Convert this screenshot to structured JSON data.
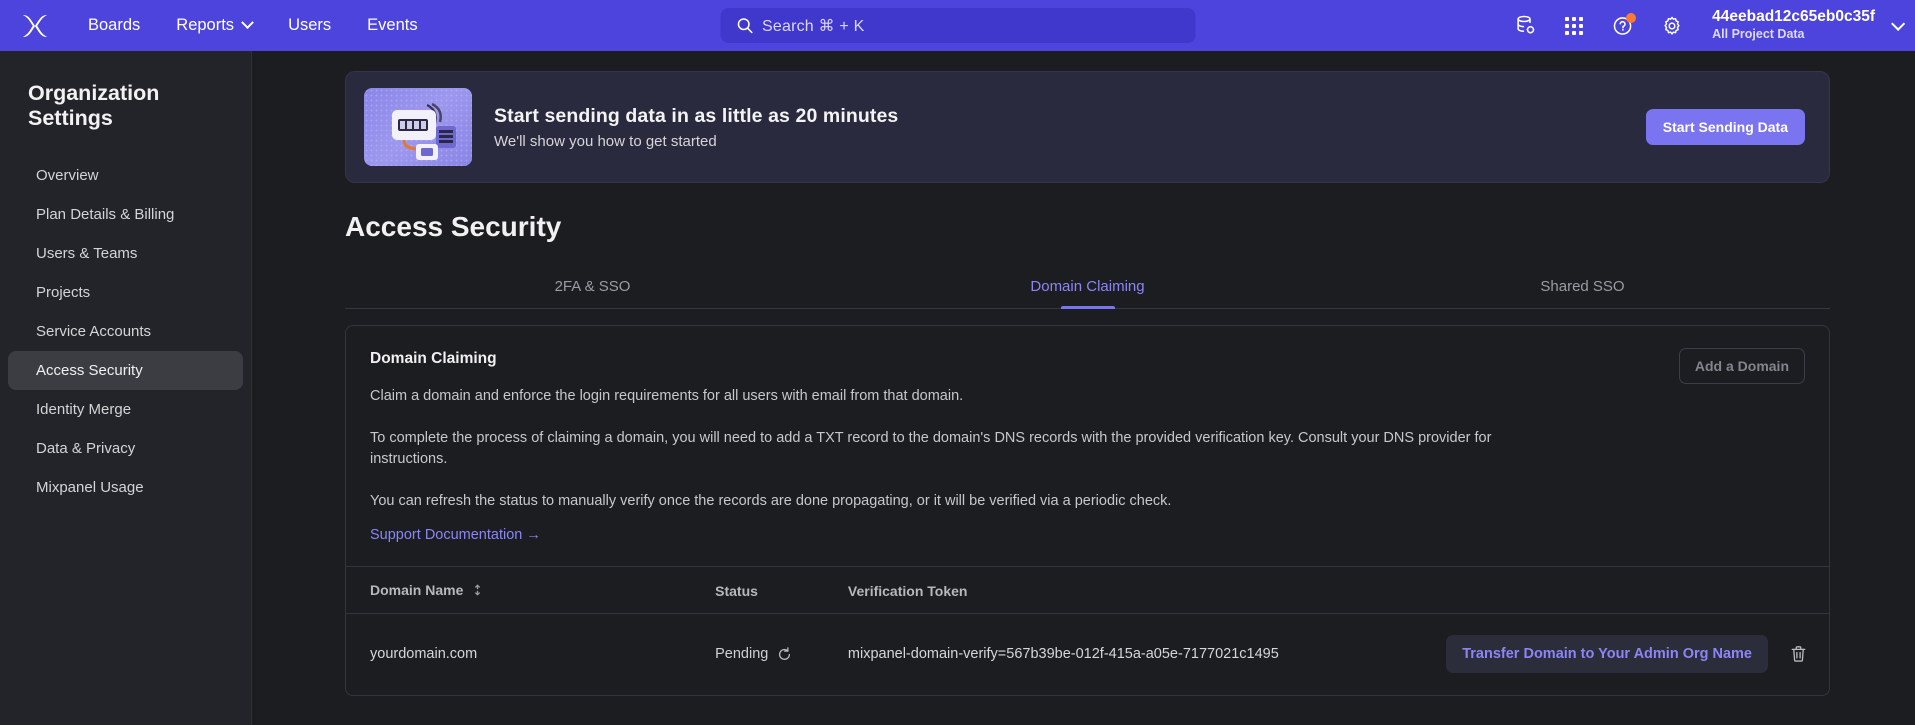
{
  "topnav": {
    "logo_name": "mixpanel-logo",
    "links": [
      {
        "label": "Boards",
        "has_caret": false
      },
      {
        "label": "Reports",
        "has_caret": true
      },
      {
        "label": "Users",
        "has_caret": false
      },
      {
        "label": "Events",
        "has_caret": false
      }
    ],
    "search": {
      "placeholder": "Search  ⌘ + K"
    },
    "icons": [
      "database-settings-icon",
      "apps-grid-icon",
      "help-circle-icon",
      "gear-icon"
    ],
    "project": {
      "name": "44eebad12c65eb0c35f",
      "subtitle": "All Project Data"
    }
  },
  "sidebar": {
    "title": "Organization Settings",
    "items": [
      {
        "label": "Overview",
        "active": false
      },
      {
        "label": "Plan Details & Billing",
        "active": false
      },
      {
        "label": "Users & Teams",
        "active": false
      },
      {
        "label": "Projects",
        "active": false
      },
      {
        "label": "Service Accounts",
        "active": false
      },
      {
        "label": "Access Security",
        "active": true
      },
      {
        "label": "Identity Merge",
        "active": false
      },
      {
        "label": "Data & Privacy",
        "active": false
      },
      {
        "label": "Mixpanel Usage",
        "active": false
      }
    ]
  },
  "banner": {
    "title": "Start sending data in as little as 20 minutes",
    "subtitle": "We'll show you how to get started",
    "cta_label": "Start Sending Data",
    "thumb_name": "server-device-illustration"
  },
  "page": {
    "title": "Access Security",
    "tabs": [
      {
        "label": "2FA & SSO",
        "active": false
      },
      {
        "label": "Domain Claiming",
        "active": true
      },
      {
        "label": "Shared SSO",
        "active": false
      }
    ]
  },
  "card": {
    "heading": "Domain Claiming",
    "paragraphs": [
      "Claim a domain and enforce the login requirements for all users with email from that domain.",
      "To complete the process of claiming a domain, you will need to add a TXT record to the domain's DNS records with the provided verification key. Consult your DNS provider for instructions.",
      "You can refresh the status to manually verify once the records are done propagating, or it will be verified via a periodic check."
    ],
    "support_link": "Support Documentation →",
    "add_domain_label": "Add a Domain"
  },
  "table": {
    "columns": [
      "Domain Name",
      "Status",
      "Verification Token"
    ],
    "rows": [
      {
        "domain": "yourdomain.com",
        "status": "Pending",
        "token": "mixpanel-domain-verify=567b39be-012f-415a-a05e-7177021c1495",
        "transfer_label": "Transfer Domain to Your Admin Org Name"
      }
    ]
  },
  "colors": {
    "brand_purple": "#4d44dd",
    "accent_purple": "#7b74f0",
    "link_purple": "#8b85f6",
    "badge_orange": "#ff7a33",
    "page_bg": "#1b1d21",
    "sidebar_bg": "#222429"
  }
}
